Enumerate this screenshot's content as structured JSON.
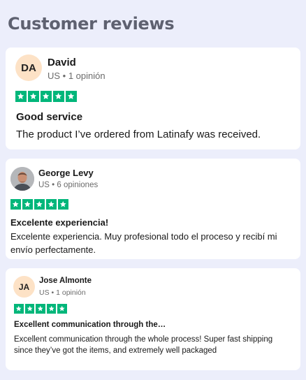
{
  "page": {
    "title": "Customer reviews"
  },
  "colors": {
    "star_green": "#00b67a",
    "avatar_bg": "#fde2c6",
    "page_bg": "#eceefb"
  },
  "reviews": [
    {
      "avatar_initials": "DA",
      "name": "David",
      "meta": "US • 1 opinión",
      "rating": 5,
      "title": "Good service",
      "body": "The product I’ve ordered from Latinafy was received."
    },
    {
      "avatar_initials": "",
      "avatar_icon": "user-photo",
      "name": "George Levy",
      "meta": "US • 6 opiniones",
      "rating": 5,
      "title": "Excelente experiencia!",
      "body": "Excelente experiencia. Muy profesional todo el proceso y recibí mi envío perfectamente."
    },
    {
      "avatar_initials": "JA",
      "name": "Jose Almonte",
      "meta": "US • 1 opinión",
      "rating": 5,
      "title": "Excellent communication through the…",
      "body": "Excellent communication through the whole process! Super fast shipping since they’ve got the items, and extremely well packaged"
    }
  ]
}
